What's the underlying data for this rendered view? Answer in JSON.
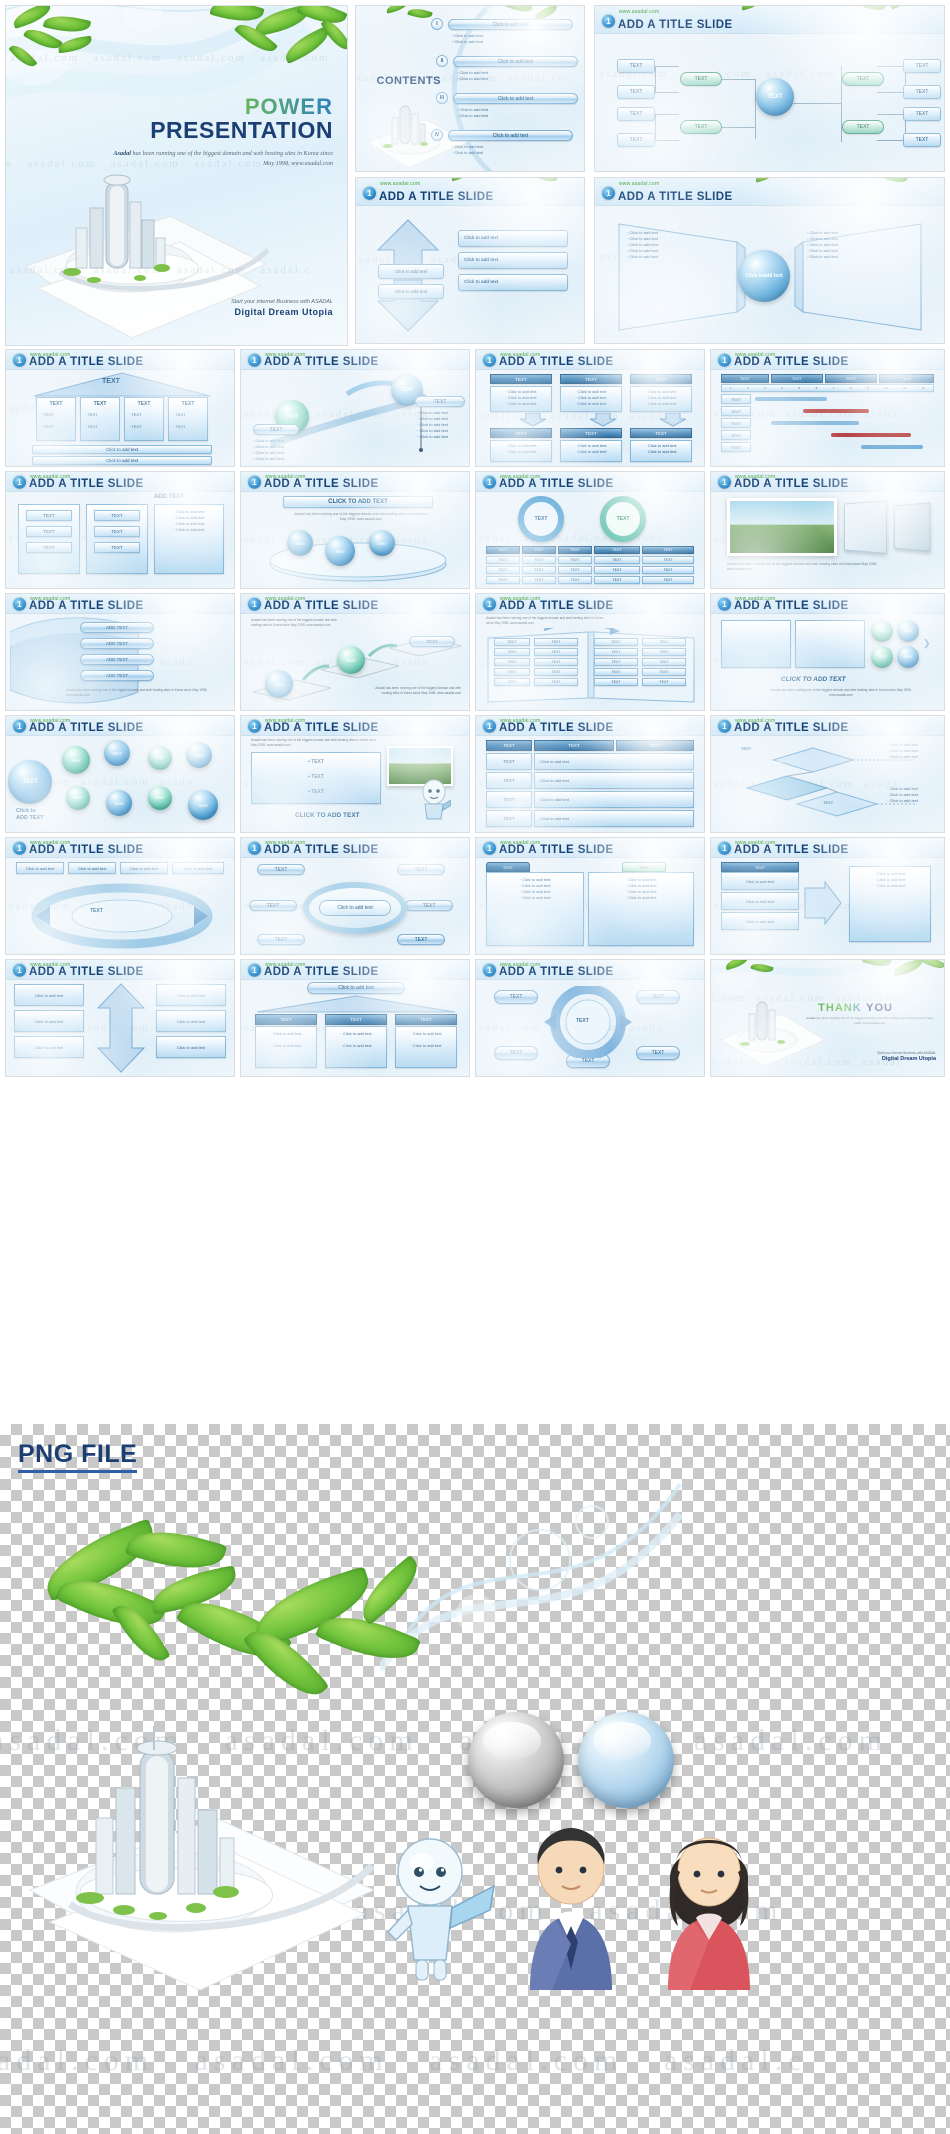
{
  "meta": {
    "watermark": "asadal.com",
    "site_url": "www.asadal.com",
    "png_section_label": "PNG FILE"
  },
  "hero": {
    "title_power": "POWER",
    "title_presentation": "PRESENTATION",
    "brand": "Asadal",
    "subtitle": " has been running one of the biggest domain and web  hosting sites in Korea since May 1998. www.asadal.com",
    "footer_line1": "Start your internet Business with ASADAL",
    "footer_line2": "Digital  Dream  Utopia"
  },
  "thankyou": {
    "thanks": "THANK",
    "you": "YOU",
    "brand": "Asadal",
    "subtitle": " has been running one of the biggest domain and web  hosting sites in Korea since May 1998. www.asadal.com",
    "footer_line1": "Start your internet Business with ASADAL",
    "footer_line2": "Digital  Dream  Utopia"
  },
  "contents": {
    "heading": "CONTENTS",
    "numerals": [
      "I",
      "II",
      "III",
      "IV"
    ],
    "bar_label": "Click to add text",
    "bullet_label": "Click to add text"
  },
  "slide_header": {
    "url": "www.asadal.com",
    "badge": "1",
    "title": "ADD A TITLE SLIDE"
  },
  "labels": {
    "text": "TEXT",
    "add_text": "ADD TEXT",
    "click_to_add_text": "Click to add text",
    "click_to_add_text_caps": "CLICK TO ADD TEXT",
    "click_to_add_text_title": "CLICK TO ADD TEXT",
    "click_add": "Click to",
    "add": "add text",
    "bullet": "Click to add text",
    "body_copy": "Asadal has been running one of the biggest domain and web  hosting sites in Korea since May 1998. www.asadal.com"
  },
  "slides": [
    {
      "index": 1,
      "name": "title-cover",
      "kind": "hero"
    },
    {
      "index": 2,
      "name": "contents",
      "kind": "contents"
    },
    {
      "index": 3,
      "name": "org-chart",
      "kind": "orgchart"
    },
    {
      "index": 4,
      "name": "arrows-steps",
      "kind": "arrows"
    },
    {
      "index": 5,
      "name": "opposing-panels",
      "kind": "panels"
    },
    {
      "index": 6,
      "name": "temple-columns",
      "kind": "temple"
    },
    {
      "index": 7,
      "name": "stairs-process",
      "kind": "stairs"
    },
    {
      "index": 8,
      "name": "matrix-table",
      "kind": "matrix"
    },
    {
      "index": 9,
      "name": "gantt-table",
      "kind": "gantt"
    },
    {
      "index": 10,
      "name": "three-cards",
      "kind": "cards"
    },
    {
      "index": 11,
      "name": "spheres-platform",
      "kind": "platform"
    },
    {
      "index": 12,
      "name": "two-rings-table",
      "kind": "rings"
    },
    {
      "index": 13,
      "name": "photo-frames",
      "kind": "photo"
    },
    {
      "index": 14,
      "name": "ribbon-list",
      "kind": "ribbon"
    },
    {
      "index": 15,
      "name": "stepping-stones",
      "kind": "stones"
    },
    {
      "index": 16,
      "name": "book-columns",
      "kind": "book"
    },
    {
      "index": 17,
      "name": "spheres-row",
      "kind": "sphererow"
    },
    {
      "index": 18,
      "name": "bubble-cluster",
      "kind": "bubbles"
    },
    {
      "index": 19,
      "name": "screen-bullets",
      "kind": "screen"
    },
    {
      "index": 20,
      "name": "header-table",
      "kind": "table"
    },
    {
      "index": 21,
      "name": "diamond-diagram",
      "kind": "diamond"
    },
    {
      "index": 22,
      "name": "cycle-diagram",
      "kind": "cycle"
    },
    {
      "index": 23,
      "name": "oval-network",
      "kind": "oval"
    },
    {
      "index": 24,
      "name": "tabbed-panel",
      "kind": "tabs"
    },
    {
      "index": 25,
      "name": "arrow-funnel",
      "kind": "funnel"
    },
    {
      "index": 26,
      "name": "vertical-arrow",
      "kind": "vararrow"
    },
    {
      "index": 27,
      "name": "pillar-table",
      "kind": "pillars"
    },
    {
      "index": 28,
      "name": "radial-ring",
      "kind": "radial"
    },
    {
      "index": 29,
      "name": "thank-you",
      "kind": "thankyou"
    }
  ],
  "png_assets": [
    {
      "name": "leaves-branch",
      "label": ""
    },
    {
      "name": "city-on-paper",
      "label": ""
    },
    {
      "name": "grey-glass-button",
      "label": ""
    },
    {
      "name": "blue-glass-button",
      "label": ""
    },
    {
      "name": "robot-mascot",
      "label": ""
    },
    {
      "name": "businessman-avatar",
      "label": ""
    },
    {
      "name": "businesswoman-avatar",
      "label": ""
    }
  ],
  "colors": {
    "brand_blue": "#1b3f72",
    "accent_green": "#3fa535",
    "panel_blue": "#9dc9ea",
    "teal": "#5cc4ae",
    "header_blue": "#dceefa"
  }
}
